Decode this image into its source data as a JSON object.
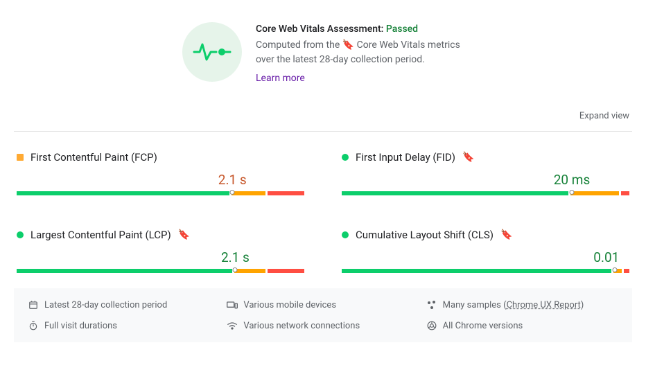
{
  "header": {
    "title_prefix": "Core Web Vitals Assessment: ",
    "status": "Passed",
    "desc_prefix": "Computed from the ",
    "desc_mid": " Core Web Vitals metrics over the latest 28-day collection period.",
    "learn_more": "Learn more"
  },
  "expand_view": "Expand view",
  "metrics": {
    "fcp": {
      "name": "First Contentful Paint (FCP)",
      "value": "2.1 s",
      "rating": "avg",
      "marker_pct": 75,
      "seg": [
        75,
        12,
        13
      ],
      "bookmark": false
    },
    "fid": {
      "name": "First Input Delay (FID)",
      "value": "20 ms",
      "rating": "good",
      "marker_pct": 80,
      "seg": [
        80,
        17,
        3
      ],
      "bookmark": true
    },
    "lcp": {
      "name": "Largest Contentful Paint (LCP)",
      "value": "2.1 s",
      "rating": "good",
      "marker_pct": 76,
      "seg": [
        76,
        11,
        13
      ],
      "bookmark": true
    },
    "cls": {
      "name": "Cumulative Layout Shift (CLS)",
      "value": "0.01",
      "rating": "good",
      "marker_pct": 95,
      "seg": [
        95,
        3,
        2
      ],
      "bookmark": true
    }
  },
  "footer": {
    "period": "Latest 28-day collection period",
    "devices": "Various mobile devices",
    "samples_prefix": "Many samples (",
    "samples_link": "Chrome UX Report",
    "samples_suffix": ")",
    "durations": "Full visit durations",
    "network": "Various network connections",
    "versions": "All Chrome versions"
  }
}
